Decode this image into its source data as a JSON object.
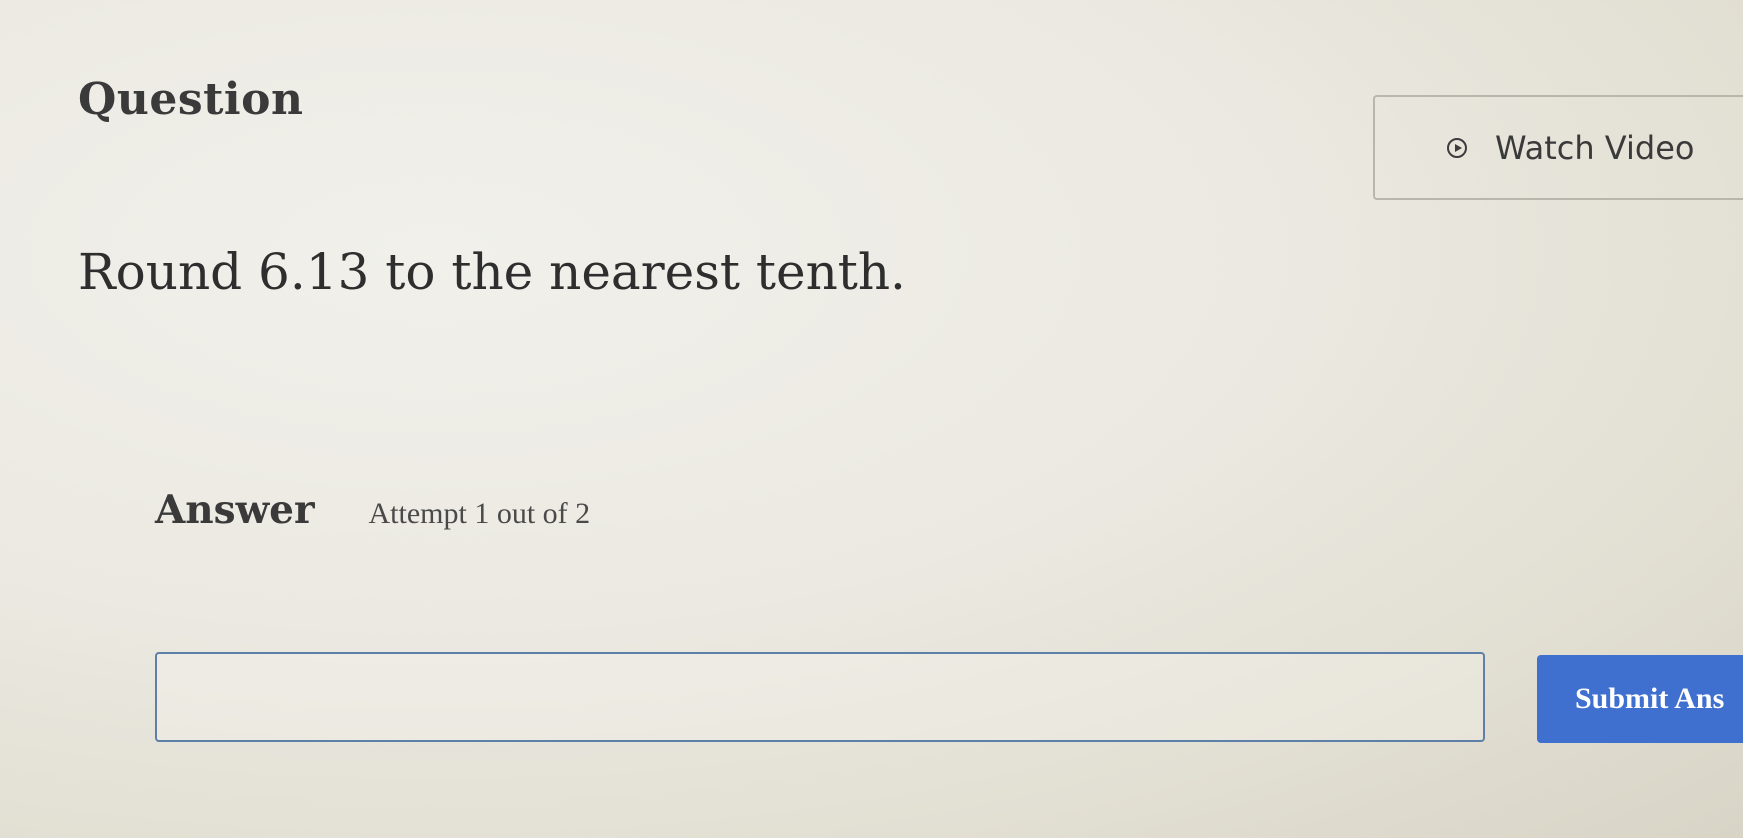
{
  "question": {
    "heading": "Question",
    "prompt": "Round 6.13 to the nearest tenth."
  },
  "watch_video": {
    "label": "Watch Video",
    "icon": "play-circle-icon"
  },
  "answer": {
    "label": "Answer",
    "attempt": "Attempt 1 out of 2",
    "input_value": "",
    "submit_label": "Submit Ans"
  },
  "colors": {
    "submit_button": "#3f6fcf",
    "input_border": "#5d7fa8"
  }
}
